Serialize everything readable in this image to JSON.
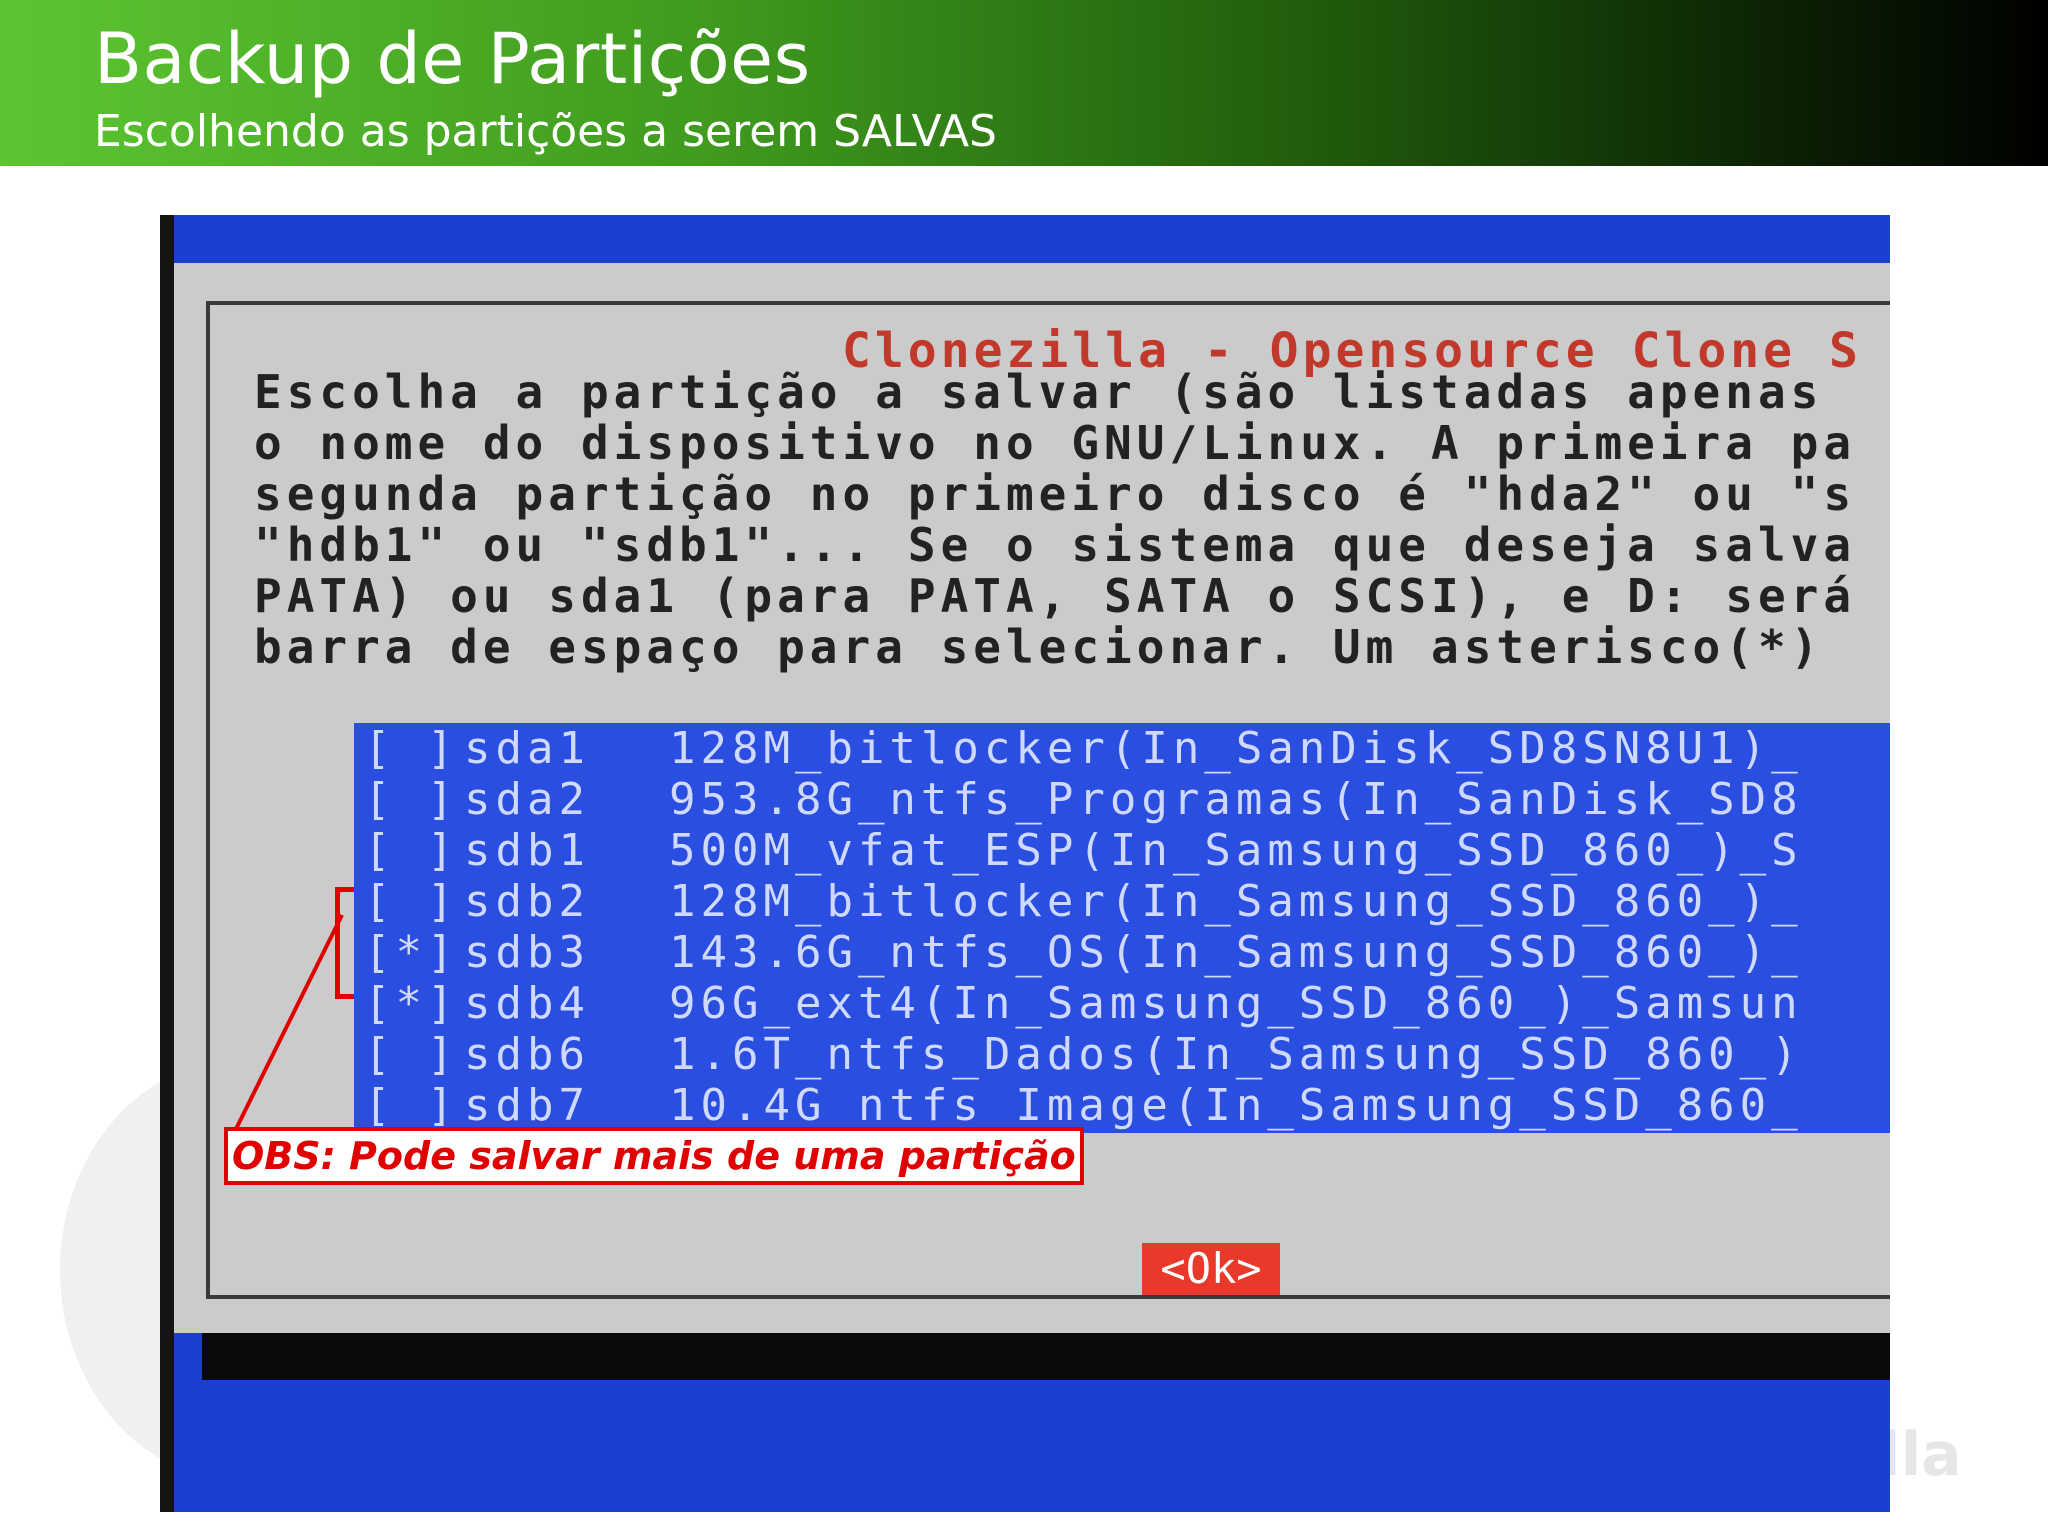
{
  "slide": {
    "title": "Backup de Partições",
    "subtitle": "Escolhendo as partições a serem SALVAS",
    "watermark": "lla"
  },
  "dialog": {
    "title": "Clonezilla - Opensource Clone S",
    "body_lines": [
      "Escolha a partição a salvar (são listadas apenas",
      "o nome do dispositivo no GNU/Linux. A primeira pa",
      "segunda partição no primeiro disco é \"hda2\" ou \"s",
      "\"hdb1\" ou \"sdb1\"... Se o sistema que deseja salva",
      "PATA) ou sda1 (para PATA, SATA o SCSI), e D: será",
      "barra de espaço para selecionar. Um asterisco(*)"
    ],
    "partitions": [
      {
        "check": "[ ]",
        "device": "sda1",
        "desc": "128M_bitlocker(In_SanDisk_SD8SN8U1)_"
      },
      {
        "check": "[ ]",
        "device": "sda2",
        "desc": "953.8G_ntfs_Programas(In_SanDisk_SD8"
      },
      {
        "check": "[ ]",
        "device": "sdb1",
        "desc": "500M_vfat_ESP(In_Samsung_SSD_860_)_S"
      },
      {
        "check": "[ ]",
        "device": "sdb2",
        "desc": "128M_bitlocker(In_Samsung_SSD_860_)_"
      },
      {
        "check": "[*]",
        "device": "sdb3",
        "desc": "143.6G_ntfs_OS(In_Samsung_SSD_860_)_"
      },
      {
        "check": "[*]",
        "device": "sdb4",
        "desc": "96G_ext4(In_Samsung_SSD_860_)_Samsun"
      },
      {
        "check": "[ ]",
        "device": "sdb6",
        "desc": "1.6T_ntfs_Dados(In_Samsung_SSD_860_)"
      },
      {
        "check": "[ ]",
        "device": "sdb7",
        "desc": "10.4G_ntfs_Image(In_Samsung_SSD_860_"
      }
    ],
    "ok_label": "<Ok>"
  },
  "annotation": {
    "note": "OBS: Pode salvar mais de uma partição",
    "color": "#e00000"
  },
  "colors": {
    "header_start": "#5cc531",
    "header_end": "#000000",
    "terminal_blue": "#1c3fcf",
    "list_blue": "#2a4fe0",
    "dialog_gray": "#cbcbcb",
    "ok_red": "#e8392a"
  }
}
